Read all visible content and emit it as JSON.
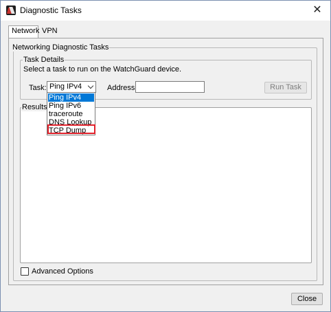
{
  "window": {
    "title": "Diagnostic Tasks",
    "close_glyph": "✕"
  },
  "tabs": [
    {
      "label": "Network",
      "active": true
    },
    {
      "label": "VPN",
      "active": false
    }
  ],
  "network_group": {
    "label": "Networking Diagnostic Tasks"
  },
  "task_details": {
    "label": "Task Details",
    "instruction": "Select a task to run on the WatchGuard device.",
    "task_label": "Task:",
    "task_selected": "Ping IPv4",
    "address_label": "Address:",
    "address_value": "",
    "run_button": "Run Task"
  },
  "task_dropdown": {
    "options": [
      "Ping IPv4",
      "Ping IPv6",
      "traceroute",
      "DNS Lookup",
      "TCP Dump"
    ],
    "highlighted_index": 0,
    "annotated_index": 4,
    "annotation_color": "#e0202a"
  },
  "results": {
    "label": "Results"
  },
  "advanced_options": {
    "label": "Advanced Options",
    "checked": false
  },
  "footer": {
    "close_button": "Close"
  },
  "colors": {
    "selection": "#0078d7",
    "dialog_bg": "#f0f0f0"
  }
}
